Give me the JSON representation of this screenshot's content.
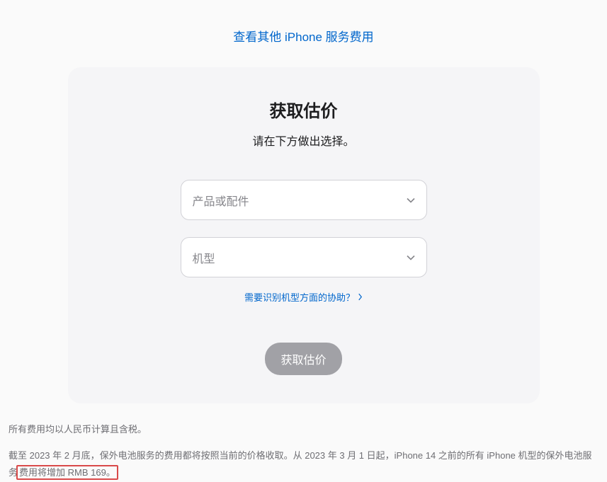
{
  "top_link": "查看其他 iPhone 服务费用",
  "card": {
    "title": "获取估价",
    "subtitle": "请在下方做出选择。",
    "product_placeholder": "产品或配件",
    "model_placeholder": "机型",
    "help_link": "需要识别机型方面的协助？",
    "cta": "获取估价"
  },
  "footer": {
    "line1": "所有费用均以人民币计算且含税。",
    "line2_pre": "截至 2023 年 2 月底，保外电池服务的费用都将按照当前的价格收取。从 2023 年 3 月 1 日起，iPhone 14 之前的所有 iPhone 机型的保外电池服务",
    "line2_highlight": "费用将增加 RMB 169。"
  }
}
